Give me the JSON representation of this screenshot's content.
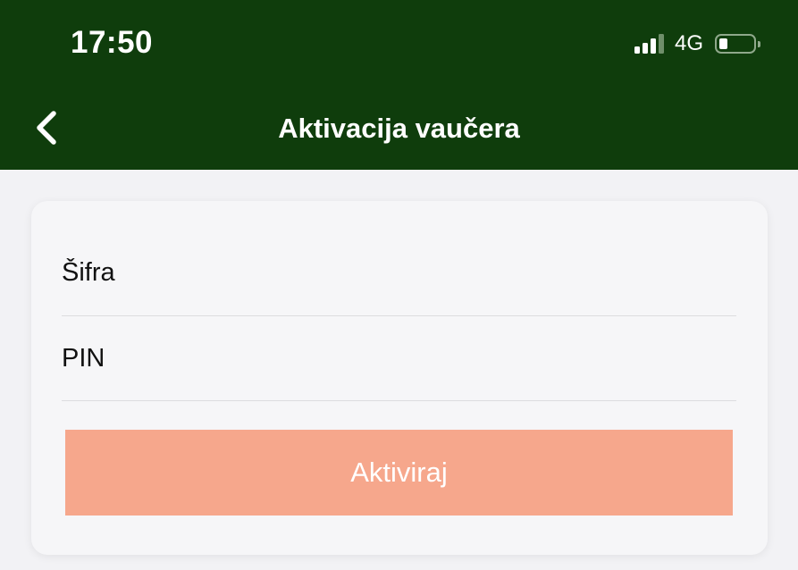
{
  "status_bar": {
    "time": "17:50",
    "network": "4G",
    "icons": [
      "signal-icon",
      "battery-icon"
    ]
  },
  "nav": {
    "back_icon": "chevron-left-icon",
    "title": "Aktivacija vaučera"
  },
  "form": {
    "code_field": {
      "placeholder": "Šifra",
      "value": ""
    },
    "pin_field": {
      "placeholder": "PIN",
      "value": ""
    },
    "submit_label": "Aktiviraj"
  },
  "colors": {
    "header_bg": "#0f3d0c",
    "page_bg": "#f2f2f5",
    "card_bg": "#f6f6f8",
    "button_bg": "#f6a78c",
    "button_text": "#ffffff"
  }
}
